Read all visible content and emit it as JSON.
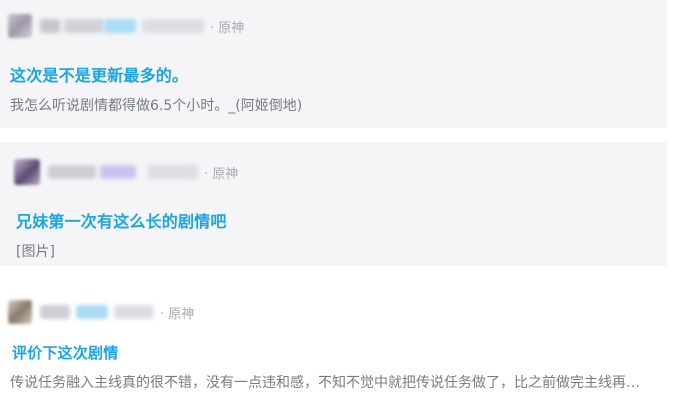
{
  "posts": [
    {
      "tag": "· 原神",
      "title": "这次是不是更新最多的。",
      "snippet": "我怎么听说剧情都得做6.5个小时。_(阿姬倒地)"
    },
    {
      "tag": "· 原神",
      "title": "兄妹第一次有这么长的剧情吧",
      "snippet": "[图片]"
    },
    {
      "tag": "· 原神",
      "title": "评价下这次剧情",
      "snippet": "传说任务融入主线真的很不错，没有一点违和感，不知不觉中就把传说任务做了，比之前做完主线再…"
    }
  ],
  "colors": {
    "title": "#1aa5e6",
    "snippet": "#777b82",
    "tag": "#a9a9b0",
    "card_bg": "#f5f5f7"
  }
}
